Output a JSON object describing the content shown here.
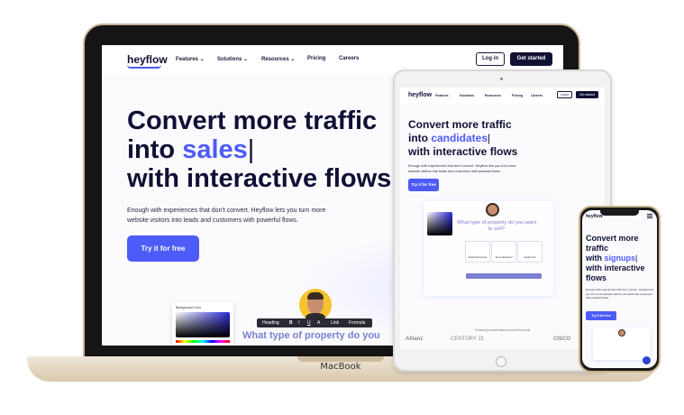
{
  "laptop": {
    "label": "MacBook",
    "nav": {
      "logo": "heyflow",
      "items": [
        "Features",
        "Solutions",
        "Resources",
        "Pricing",
        "Careers"
      ],
      "chevrons": [
        "⌄",
        "⌄",
        "⌄",
        "",
        ""
      ],
      "login": "Log in",
      "get_started": "Get started"
    },
    "hero": {
      "line1": "Convert more traffic",
      "line2_prefix": "into ",
      "line2_accent": "sales",
      "cursor": "|",
      "line3": "with interactive flows",
      "subtitle": "Enough with experiences that don't convert. Heyflow lets you turn more website visitors into leads and customers with powerful flows.",
      "cta": "Try it for free"
    },
    "editor": {
      "color_card_title": "Background Color",
      "toolbar": [
        "Heading",
        "B",
        "I",
        "U",
        "A",
        "Link",
        "Formula"
      ],
      "question": "What type of property do you"
    }
  },
  "tablet": {
    "nav": {
      "logo": "heyflow",
      "items": [
        "Features",
        "Solutions",
        "Resources",
        "Pricing",
        "Careers"
      ],
      "login": "Log in",
      "get_started": "Get started"
    },
    "hero": {
      "line1": "Convert more traffic",
      "line2_prefix": "into ",
      "line2_accent": "candidates",
      "cursor": "|",
      "line3": "with interactive flows",
      "subtitle": "Enough with experiences that don't convert. Heyflow lets you turn more website visitors into leads and customers with powerful flows.",
      "cta": "Try it for free"
    },
    "flow": {
      "question": "What type of property do you want to sell?",
      "options": [
        "Detached House",
        "Semi-detached",
        "Apartment"
      ]
    },
    "trusted": "Trusted by market leaders around the world",
    "logos": [
      "Allianz",
      "CENTURY 21",
      "CISCO"
    ]
  },
  "phone": {
    "logo": "heyflow",
    "hero": {
      "line1": "Convert more traffic",
      "line2_prefix": "with ",
      "line2_accent": "signups",
      "cursor": "|",
      "line3": "with interactive flows",
      "subtitle": "Enough with experiences that don't convert. Heyflow lets you turn more website visitors into leads and customers with powerful flows.",
      "cta": "Try it for free"
    }
  },
  "colors": {
    "accent": "#4d5bf9",
    "navy": "#101035",
    "question": "#7b7fd0",
    "avatar_bg": "#f6c22e"
  }
}
